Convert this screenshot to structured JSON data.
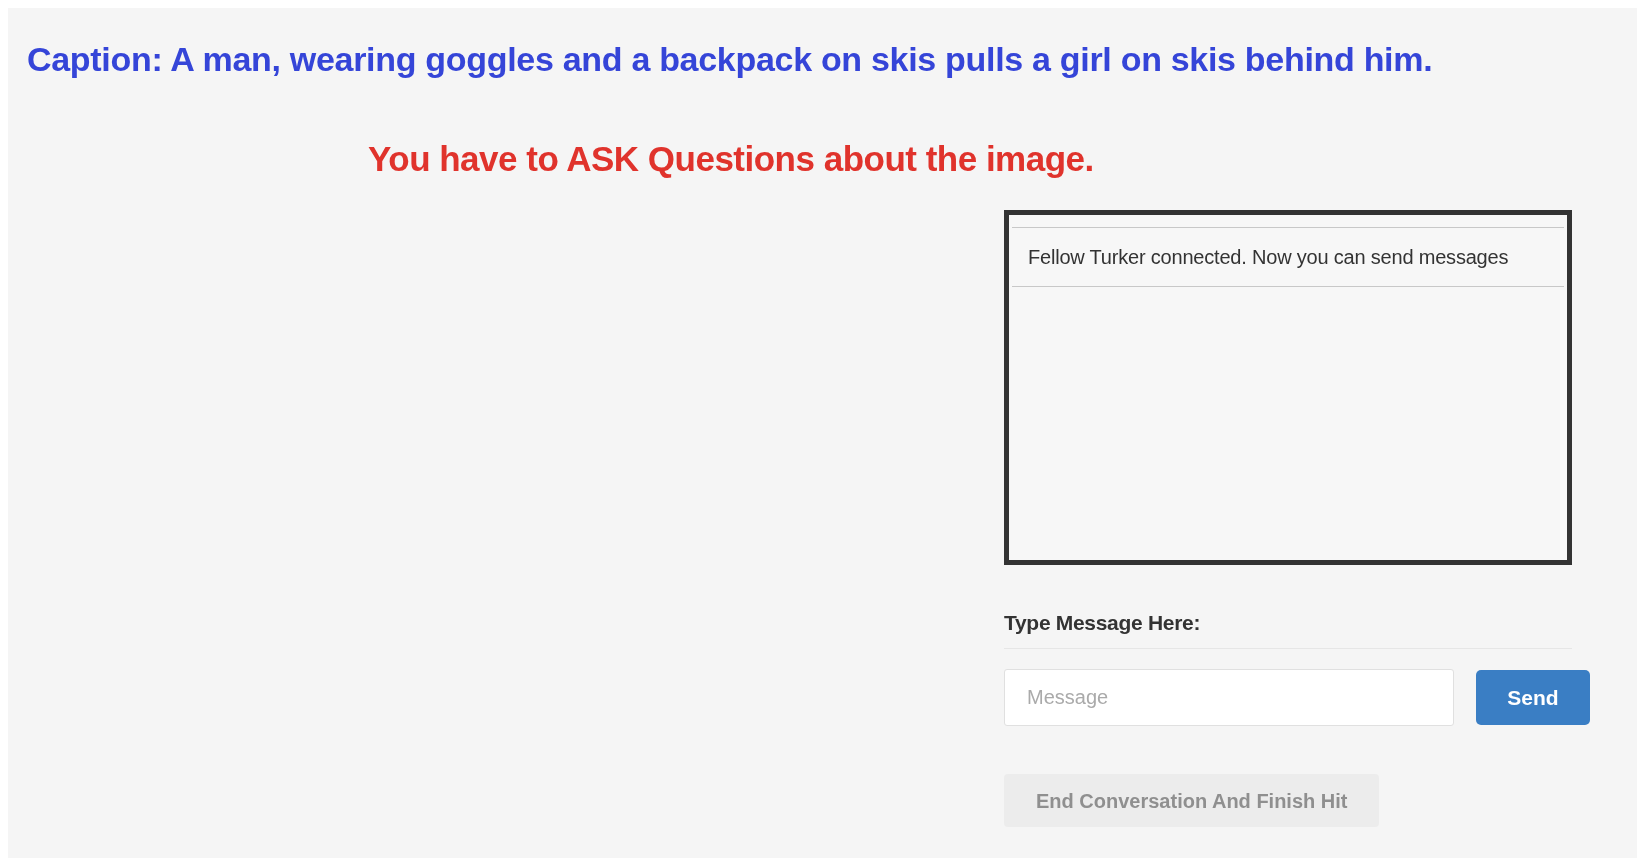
{
  "caption": "Caption: A man, wearing goggles and a backpack on skis pulls a girl on skis behind him.",
  "instruction": "You have to ASK Questions about the image.",
  "chat": {
    "messages": [
      "Fellow Turker connected. Now you can send messages"
    ]
  },
  "compose": {
    "label": "Type Message Here:",
    "placeholder": "Message",
    "send_button": "Send"
  },
  "end_button": {
    "label": "End Conversation And Finish Hit",
    "disabled": true
  }
}
